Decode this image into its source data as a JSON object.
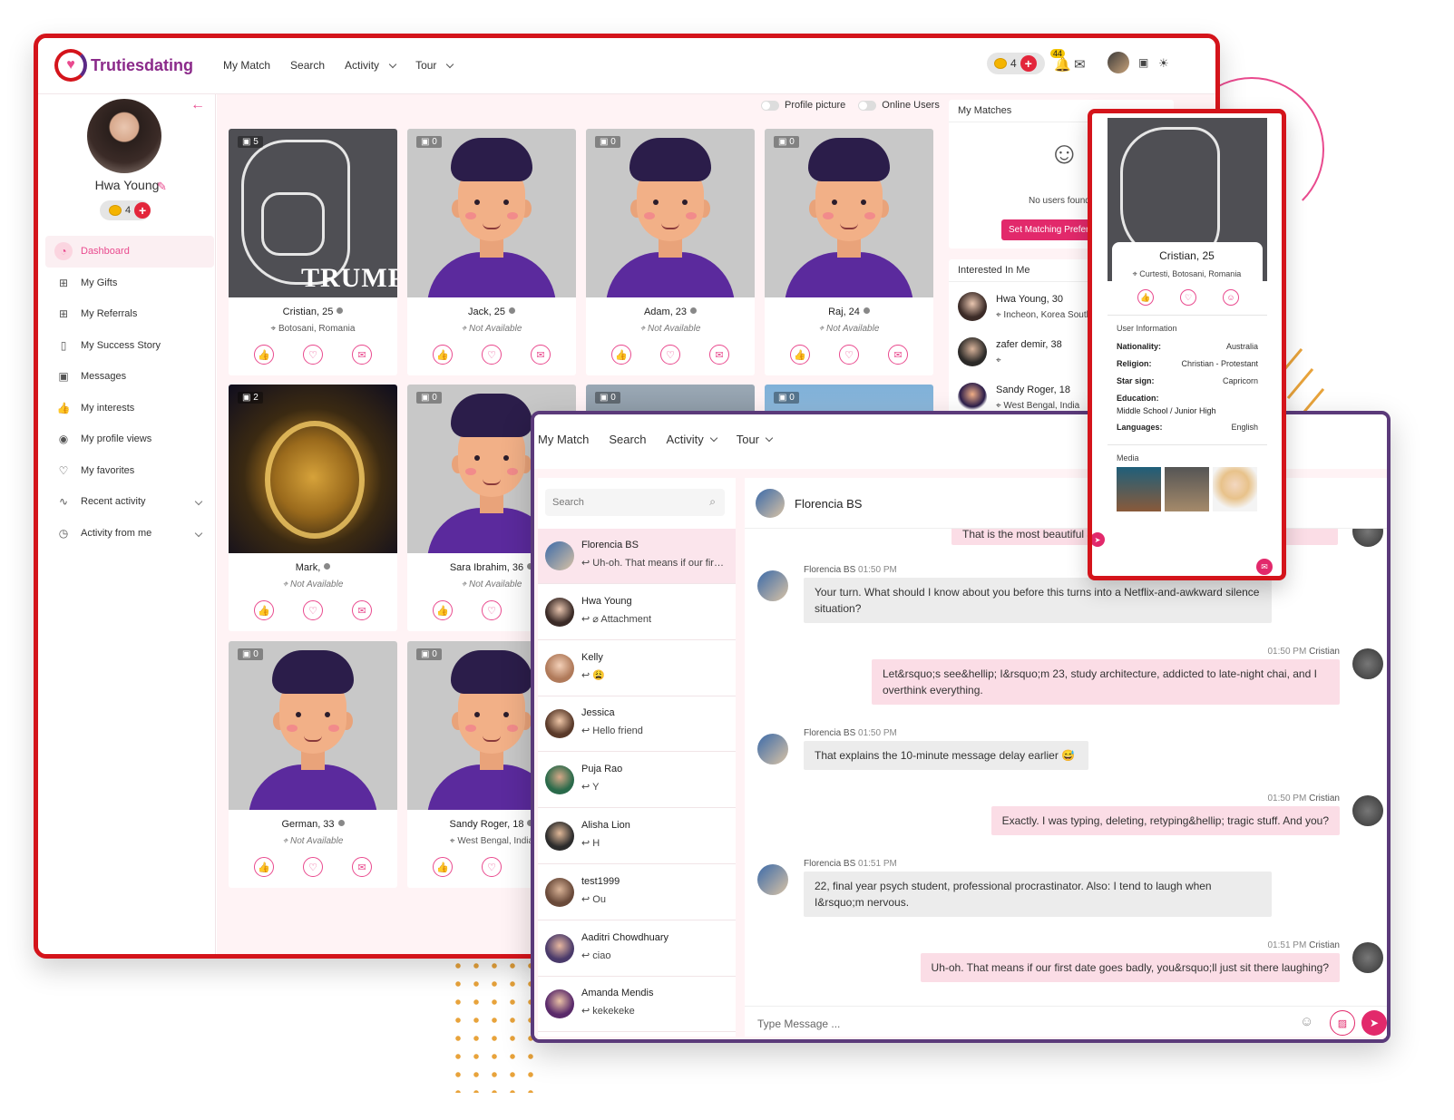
{
  "brand": {
    "logo_text": "Trutiesdating"
  },
  "topnav": {
    "items": [
      "My Match",
      "Search",
      "Activity",
      "Tour"
    ],
    "coins": "4",
    "notif_badge": "44"
  },
  "sidebar": {
    "user_name": "Hwa Young",
    "coins": "4",
    "menu": [
      {
        "label": "Dashboard",
        "icon": "dashboard-icon",
        "active": true
      },
      {
        "label": "My Gifts",
        "icon": "gift-icon"
      },
      {
        "label": "My Referrals",
        "icon": "gift-icon"
      },
      {
        "label": "My Success Story",
        "icon": "book-icon"
      },
      {
        "label": "Messages",
        "icon": "message-heart-icon"
      },
      {
        "label": "My interests",
        "icon": "thumbs-up-icon"
      },
      {
        "label": "My profile views",
        "icon": "eye-icon"
      },
      {
        "label": "My favorites",
        "icon": "heart-icon"
      },
      {
        "label": "Recent activity",
        "icon": "pulse-icon",
        "expandable": true
      },
      {
        "label": "Activity from me",
        "icon": "clock-icon",
        "expandable": true
      }
    ]
  },
  "filters": {
    "profile_picture": "Profile picture",
    "online_users": "Online Users"
  },
  "cards": [
    {
      "name": "Cristian, 25",
      "location": "Botosani, Romania",
      "photos": "5",
      "photo": "cartoon",
      "word": "TRUMP"
    },
    {
      "name": "Jack, 25",
      "location": "Not Available",
      "photos": "0",
      "photo": "avatar"
    },
    {
      "name": "Adam, 23",
      "location": "Not Available",
      "photos": "0",
      "photo": "avatar"
    },
    {
      "name": "Raj, 24",
      "location": "Not Available",
      "photos": "0",
      "photo": "avatar"
    },
    {
      "name": "Mark,",
      "location": "Not Available",
      "photos": "2",
      "photo": "lion"
    },
    {
      "name": "Sara Ibrahim, 36",
      "location": "Not Available",
      "photos": "0",
      "photo": "avatar"
    },
    {
      "name": "",
      "location": "",
      "photos": "0",
      "photo": "photo"
    },
    {
      "name": "",
      "location": "",
      "photos": "0",
      "photo": "sky"
    },
    {
      "name": "German, 33",
      "location": "Not Available",
      "photos": "0",
      "photo": "avatar"
    },
    {
      "name": "Sandy Roger, 18",
      "location": "West Bengal, India",
      "photos": "0",
      "photo": "avatar"
    },
    {
      "name": "",
      "location": "",
      "photos": "0",
      "photo": "avatar"
    },
    {
      "name": "",
      "location": "",
      "photos": "0",
      "photo": "avatar"
    }
  ],
  "my_matches": {
    "title": "My Matches",
    "empty_text": "No users found",
    "button": "Set Matching Preferences"
  },
  "interested": {
    "title": "Interested In Me",
    "items": [
      {
        "name": "Hwa Young, 30",
        "location": "Incheon, Korea South"
      },
      {
        "name": "zafer demir, 38",
        "location": ""
      },
      {
        "name": "Sandy Roger, 18",
        "location": "West Bengal, India"
      }
    ]
  },
  "chat": {
    "nav": [
      "My Match",
      "Search",
      "Activity",
      "Tour"
    ],
    "search_placeholder": "Search",
    "contacts": [
      {
        "name": "Florencia BS",
        "preview": "Uh-oh. That means if our first date goes badly",
        "selected": true
      },
      {
        "name": "Hwa Young",
        "preview": "Attachment"
      },
      {
        "name": "Kelly",
        "preview": "😩"
      },
      {
        "name": "Jessica",
        "preview": "Hello friend"
      },
      {
        "name": "Puja Rao",
        "preview": "Y"
      },
      {
        "name": "Alisha Lion",
        "preview": "H"
      },
      {
        "name": "test1999",
        "preview": "Ou"
      },
      {
        "name": "Aaditri Chowdhuary",
        "preview": "ciao"
      },
      {
        "name": "Amanda Mendis",
        "preview": "kekekeke"
      }
    ],
    "header_name": "Florencia BS",
    "partial_top": "That is the most beautiful answer I've ever heard. I'm impressed.",
    "messages": [
      {
        "dir": "in",
        "sender": "Florencia BS",
        "time": "01:50 PM",
        "text": "Your turn. What should I know about you before this turns into a Netflix-and-awkward silence situation?"
      },
      {
        "dir": "out",
        "sender": "Cristian",
        "time": "01:50 PM",
        "text": "Let&rsquo;s see&hellip; I&rsquo;m 23, study architecture, addicted to late-night chai, and I overthink everything."
      },
      {
        "dir": "in",
        "sender": "Florencia BS",
        "time": "01:50 PM",
        "text": "That explains the 10-minute message delay earlier 😅"
      },
      {
        "dir": "out",
        "sender": "Cristian",
        "time": "01:50 PM",
        "text": "Exactly. I was typing, deleting, retyping&hellip; tragic stuff. And you?"
      },
      {
        "dir": "in",
        "sender": "Florencia BS",
        "time": "01:51 PM",
        "text": "22, final year psych student, professional procrastinator. Also: I tend to laugh when I&rsquo;m nervous."
      },
      {
        "dir": "out",
        "sender": "Cristian",
        "time": "01:51 PM",
        "text": "Uh-oh. That means if our first date goes badly, you&rsquo;ll just sit there laughing?"
      }
    ],
    "input_placeholder": "Type Message ..."
  },
  "profile_popup": {
    "name": "Cristian, 25",
    "location": "Curtesti, Botosani, Romania",
    "section_title": "User Information",
    "fields": [
      {
        "key": "Nationality:",
        "value": "Australia"
      },
      {
        "key": "Religion:",
        "value": "Christian - Protestant"
      },
      {
        "key": "Star sign:",
        "value": "Capricorn"
      },
      {
        "key": "Education:",
        "value": "Middle School / Junior High"
      },
      {
        "key": "Languages:",
        "value": "English"
      }
    ],
    "media_title": "Media"
  },
  "colors": {
    "accent": "#e2296b",
    "frame_red": "#d4141b",
    "frame_purple": "#5b3a7a",
    "bg_pink": "#fff3f5"
  }
}
